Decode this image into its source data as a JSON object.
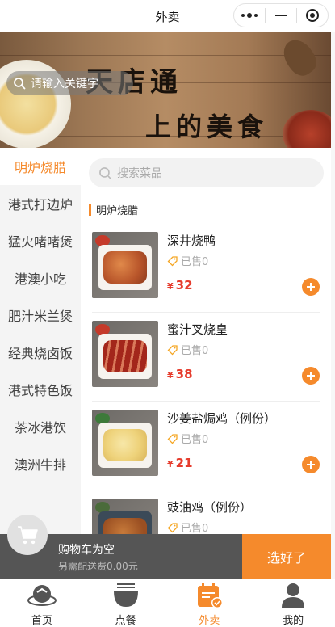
{
  "header": {
    "title": "外卖"
  },
  "banner": {
    "search_placeholder": "请输入关键字",
    "line1": "天店通",
    "line2": "上的美食"
  },
  "sidebar": {
    "categories": [
      {
        "label": "明炉烧腊"
      },
      {
        "label": "港式打边炉"
      },
      {
        "label": "猛火啫啫煲"
      },
      {
        "label": "港澳小吃"
      },
      {
        "label": "肥汁米兰煲"
      },
      {
        "label": "经典烧卤饭"
      },
      {
        "label": "港式特色饭"
      },
      {
        "label": "茶冰港饮"
      },
      {
        "label": "澳洲牛排"
      }
    ]
  },
  "main": {
    "search_placeholder": "搜索菜品",
    "section_title": "明炉烧腊",
    "currency": "¥",
    "items": [
      {
        "name": "深井烧鸭",
        "sold": "已售0",
        "price": "32"
      },
      {
        "name": "蜜汁叉烧皇",
        "sold": "已售0",
        "price": "38"
      },
      {
        "name": "沙姜盐焗鸡（例份）",
        "sold": "已售0",
        "price": "21"
      },
      {
        "name": "豉油鸡（例份）",
        "sold": "已售0",
        "price": ""
      }
    ]
  },
  "cart": {
    "empty_text": "购物车为空",
    "fee_text": "另需配送费0.00元",
    "checkout_label": "选好了"
  },
  "tabbar": {
    "tabs": [
      {
        "label": "首页",
        "icon": "home-icon"
      },
      {
        "label": "点餐",
        "icon": "bowl-icon"
      },
      {
        "label": "外卖",
        "icon": "calendar-icon"
      },
      {
        "label": "我的",
        "icon": "user-icon"
      }
    ],
    "active_color": "#f58a2c"
  },
  "colors": {
    "accent": "#f58a2c",
    "price": "#e63c2d",
    "cart_bar": "#555555"
  }
}
